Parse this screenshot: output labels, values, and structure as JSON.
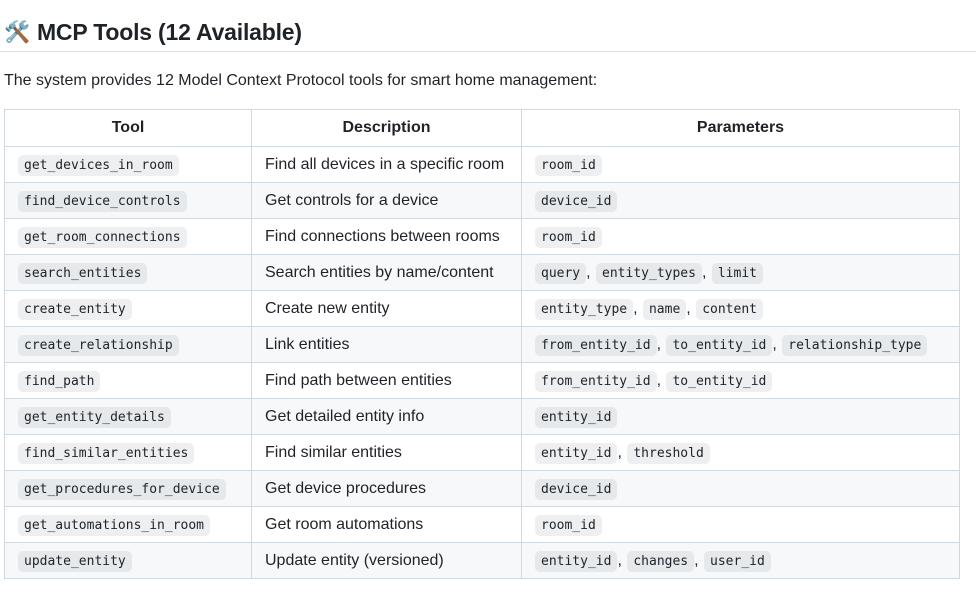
{
  "heading": {
    "emoji": "🛠️",
    "text": "MCP Tools (12 Available)"
  },
  "intro": "The system provides 12 Model Context Protocol tools for smart home management:",
  "table": {
    "headers": [
      "Tool",
      "Description",
      "Parameters"
    ],
    "rows": [
      {
        "tool": "get_devices_in_room",
        "description": "Find all devices in a specific room",
        "params": [
          "room_id"
        ]
      },
      {
        "tool": "find_device_controls",
        "description": "Get controls for a device",
        "params": [
          "device_id"
        ]
      },
      {
        "tool": "get_room_connections",
        "description": "Find connections between rooms",
        "params": [
          "room_id"
        ]
      },
      {
        "tool": "search_entities",
        "description": "Search entities by name/content",
        "params": [
          "query",
          "entity_types",
          "limit"
        ]
      },
      {
        "tool": "create_entity",
        "description": "Create new entity",
        "params": [
          "entity_type",
          "name",
          "content"
        ]
      },
      {
        "tool": "create_relationship",
        "description": "Link entities",
        "params": [
          "from_entity_id",
          "to_entity_id",
          "relationship_type"
        ]
      },
      {
        "tool": "find_path",
        "description": "Find path between entities",
        "params": [
          "from_entity_id",
          "to_entity_id"
        ]
      },
      {
        "tool": "get_entity_details",
        "description": "Get detailed entity info",
        "params": [
          "entity_id"
        ]
      },
      {
        "tool": "find_similar_entities",
        "description": "Find similar entities",
        "params": [
          "entity_id",
          "threshold"
        ]
      },
      {
        "tool": "get_procedures_for_device",
        "description": "Get device procedures",
        "params": [
          "device_id"
        ]
      },
      {
        "tool": "get_automations_in_room",
        "description": "Get room automations",
        "params": [
          "room_id"
        ]
      },
      {
        "tool": "update_entity",
        "description": "Update entity (versioned)",
        "params": [
          "entity_id",
          "changes",
          "user_id"
        ]
      }
    ]
  }
}
